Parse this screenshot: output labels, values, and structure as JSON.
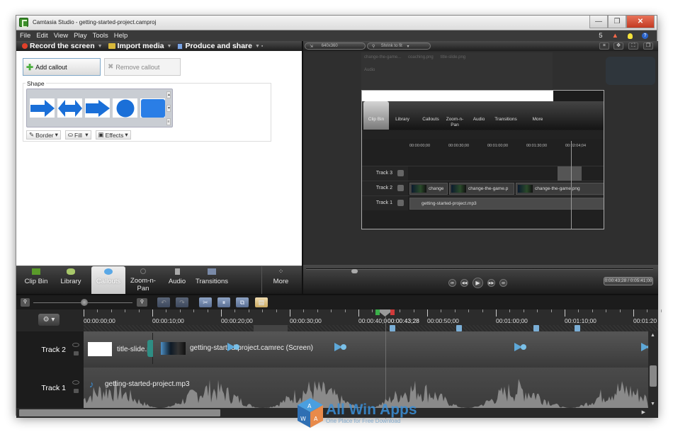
{
  "window": {
    "title": "Camtasia Studio - getting-started-project.camproj",
    "controls": {
      "minimize": "—",
      "maximize": "❐",
      "close": "✕"
    }
  },
  "menu": {
    "items": [
      "File",
      "Edit",
      "View",
      "Play",
      "Tools",
      "Help"
    ],
    "notification_count": "5"
  },
  "toolbar": {
    "record": "Record the screen",
    "import": "Import media",
    "produce": "Produce and share"
  },
  "callouts_panel": {
    "add_label": "Add callout",
    "remove_label": "Remove callout",
    "shape_group_label": "Shape",
    "shapes": [
      "arrow-right",
      "arrow-double",
      "arrow-chevron",
      "circle",
      "rounded-rectangle"
    ],
    "border_label": "Border",
    "fill_label": "Fill",
    "effects_label": "Effects"
  },
  "task_tabs": [
    {
      "label": "Clip Bin",
      "icon": "film-icon"
    },
    {
      "label": "Library",
      "icon": "library-icon"
    },
    {
      "label": "Callouts",
      "icon": "callout-bubble-icon",
      "active": true
    },
    {
      "label": "Zoom-n-\nPan",
      "icon": "magnifier-icon"
    },
    {
      "label": "Audio",
      "icon": "speaker-icon"
    },
    {
      "label": "Transitions",
      "icon": "transitions-icon"
    },
    {
      "label": "More",
      "icon": "more-dots-icon"
    }
  ],
  "preview": {
    "dimensions": "640x360",
    "zoom_mode": "Shrink to fit",
    "nested": {
      "bin_items": [
        "change-the-game...",
        "coaching.png",
        "title-slide.png"
      ],
      "audio_label": "Audio",
      "tabs": [
        "Clip Bin",
        "Library",
        "Callouts",
        "Zoom-n-\nPan",
        "Audio",
        "Transitions",
        "More"
      ],
      "ruler_labels": [
        "00:00:00;00",
        "00:00:30;00",
        "00:01:00;00",
        "00:01:30;00",
        "00:02:04;04"
      ],
      "tracks": [
        {
          "label": "Track 3",
          "clips": []
        },
        {
          "label": "Track 2",
          "clips": [
            "change",
            "change-the-game.p",
            "change-the-game.png"
          ]
        },
        {
          "label": "Track 1",
          "clips": [
            "getting-started-project.mp3"
          ]
        }
      ]
    },
    "time_display": "0:00:43;28 / 0:05:41;00",
    "scrub_progress": 0.13
  },
  "timeline": {
    "ruler_labels": [
      "00:00:00;00",
      "00:00:10;00",
      "00:00:20;00",
      "00:00:30;00",
      "00:00:40;0",
      "00:00:50;00",
      "00:01:00;00",
      "00:01:10;00",
      "00:01:20"
    ],
    "playhead_time": "00:00:43;28",
    "zoom_level": 0.55,
    "tracks": [
      {
        "label": "Track 2",
        "clips": [
          "title-slide.p",
          "getting-started-project.camrec (Screen)"
        ]
      },
      {
        "label": "Track 1",
        "clips": [
          "getting-started-project.mp3"
        ]
      }
    ]
  },
  "watermark": {
    "title": "All Win Apps",
    "subtitle": "One Place for Free Download"
  }
}
